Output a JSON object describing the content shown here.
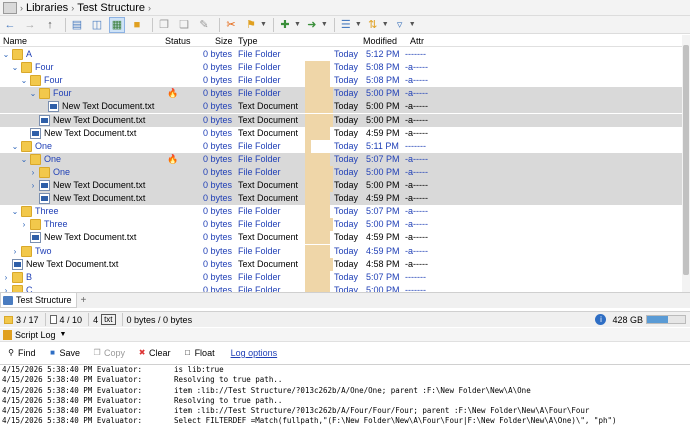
{
  "breadcrumb": [
    "Libraries",
    "Test Structure"
  ],
  "columns": {
    "name": "Name",
    "status": "Status",
    "size": "Size",
    "type": "Type",
    "modified": "Modified",
    "attr": "Attr"
  },
  "rows": [
    {
      "chev": "v",
      "icon": "folder",
      "name": "A",
      "status": "",
      "size": "0 bytes",
      "type": "File Folder",
      "day": "Today",
      "time": "5:12 PM",
      "attr": "-------",
      "style": "blue",
      "age": 0.0
    },
    {
      "chev": "v",
      "icon": "folder",
      "name": "Four",
      "status": "",
      "size": "0 bytes",
      "type": "File Folder",
      "day": "Today",
      "time": "5:08 PM",
      "attr": "-a-----",
      "style": "blue",
      "age": 0.9
    },
    {
      "chev": "v",
      "icon": "folder",
      "name": "Four",
      "status": "",
      "size": "0 bytes",
      "type": "File Folder",
      "day": "Today",
      "time": "5:08 PM",
      "attr": "-a-----",
      "style": "blue",
      "age": 0.9
    },
    {
      "chev": "v",
      "icon": "folder",
      "name": "Four",
      "status": "fire",
      "size": "0 bytes",
      "type": "File Folder",
      "day": "Today",
      "time": "5:00 PM",
      "attr": "-a-----",
      "style": "blue",
      "age": 1.0,
      "hl": true
    },
    {
      "chev": "",
      "icon": "file",
      "name": "New Text Document.txt",
      "status": "",
      "size": "0 bytes",
      "type": "Text Document",
      "day": "Today",
      "time": "5:00 PM",
      "attr": "-a-----",
      "style": "black",
      "age": 1.0,
      "hl": true
    },
    {
      "chev": "",
      "icon": "file",
      "name": "New Text Document.txt",
      "status": "",
      "size": "0 bytes",
      "type": "Text Document",
      "day": "Today",
      "time": "5:00 PM",
      "attr": "-a-----",
      "style": "black",
      "age": 1.0,
      "hl": true
    },
    {
      "chev": "",
      "icon": "file",
      "name": "New Text Document.txt",
      "status": "",
      "size": "0 bytes",
      "type": "Text Document",
      "day": "Today",
      "time": "4:59 PM",
      "attr": "-a-----",
      "style": "black",
      "age": 0.9
    },
    {
      "chev": "v",
      "icon": "folder",
      "name": "One",
      "status": "",
      "size": "0 bytes",
      "type": "File Folder",
      "day": "Today",
      "time": "5:11 PM",
      "attr": "-------",
      "style": "blue",
      "age": 0.2
    },
    {
      "chev": "v",
      "icon": "folder",
      "name": "One",
      "status": "fire",
      "size": "0 bytes",
      "type": "File Folder",
      "day": "Today",
      "time": "5:07 PM",
      "attr": "-a-----",
      "style": "blue",
      "age": 0.9,
      "hl": true
    },
    {
      "chev": ">",
      "icon": "folder",
      "name": "One",
      "status": "",
      "size": "0 bytes",
      "type": "File Folder",
      "day": "Today",
      "time": "5:00 PM",
      "attr": "-a-----",
      "style": "blue",
      "age": 1.0,
      "hl": true
    },
    {
      "chev": ">",
      "icon": "file",
      "name": "New Text Document.txt",
      "status": "",
      "size": "0 bytes",
      "type": "Text Document",
      "day": "Today",
      "time": "5:00 PM",
      "attr": "-a-----",
      "style": "black",
      "age": 1.0,
      "hl": true
    },
    {
      "chev": "",
      "icon": "file",
      "name": "New Text Document.txt",
      "status": "",
      "size": "0 bytes",
      "type": "Text Document",
      "day": "Today",
      "time": "4:59 PM",
      "attr": "-a-----",
      "style": "black",
      "age": 0.9,
      "hl": true
    },
    {
      "chev": "v",
      "icon": "folder",
      "name": "Three",
      "status": "",
      "size": "0 bytes",
      "type": "File Folder",
      "day": "Today",
      "time": "5:07 PM",
      "attr": "-a-----",
      "style": "blue",
      "age": 0.9
    },
    {
      "chev": ">",
      "icon": "folder",
      "name": "Three",
      "status": "",
      "size": "0 bytes",
      "type": "File Folder",
      "day": "Today",
      "time": "5:00 PM",
      "attr": "-a-----",
      "style": "blue",
      "age": 1.0
    },
    {
      "chev": "",
      "icon": "file",
      "name": "New Text Document.txt",
      "status": "",
      "size": "0 bytes",
      "type": "Text Document",
      "day": "Today",
      "time": "4:59 PM",
      "attr": "-a-----",
      "style": "black",
      "age": 0.9
    },
    {
      "chev": ">",
      "icon": "folder",
      "name": "Two",
      "status": "",
      "size": "0 bytes",
      "type": "File Folder",
      "day": "Today",
      "time": "4:59 PM",
      "attr": "-a-----",
      "style": "blue",
      "age": 0.9
    },
    {
      "chev": "",
      "icon": "file",
      "name": "New Text Document.txt",
      "status": "",
      "size": "0 bytes",
      "type": "Text Document",
      "day": "Today",
      "time": "4:58 PM",
      "attr": "-a-----",
      "style": "black",
      "age": 1.0
    },
    {
      "chev": ">",
      "icon": "folder",
      "name": "B",
      "status": "",
      "size": "0 bytes",
      "type": "File Folder",
      "day": "Today",
      "time": "5:07 PM",
      "attr": "-------",
      "style": "blue",
      "age": 0.9
    },
    {
      "chev": ">",
      "icon": "folder",
      "name": "C",
      "status": "",
      "size": "0 bytes",
      "type": "File Folder",
      "day": "Today",
      "time": "5:00 PM",
      "attr": "-------",
      "style": "blue",
      "age": 0.9
    }
  ],
  "tabs": {
    "active": "Test Structure",
    "add": "+"
  },
  "statusbar": {
    "selected": "3 / 17",
    "files": "4 / 10",
    "count": "4",
    "count_box": "txt",
    "bytes": "0 bytes / 0 bytes",
    "info": "i",
    "drive": "428 GB",
    "drive_used": 0.55
  },
  "log": {
    "title": "Script Log",
    "buttons": {
      "find": "Find",
      "save": "Save",
      "copy": "Copy",
      "clear": "Clear",
      "float": "Float"
    },
    "options": "Log options",
    "lines": [
      {
        "ts": "4/15/2026 5:38:40 PM Evaluator:",
        "msg": "is lib:true"
      },
      {
        "ts": "4/15/2026 5:38:40 PM Evaluator:",
        "msg": "Resolving to true path.."
      },
      {
        "ts": "4/15/2026 5:38:40 PM Evaluator:",
        "msg": "item :lib://Test Structure/?013c262b/A/One/One; parent :F:\\New Folder\\New\\A\\One"
      },
      {
        "ts": "4/15/2026 5:38:40 PM Evaluator:",
        "msg": "Resolving to true path.."
      },
      {
        "ts": "4/15/2026 5:38:40 PM Evaluator:",
        "msg": "item :lib://Test Structure/?013c262b/A/Four/Four/Four; parent :F:\\New Folder\\New\\A\\Four\\Four"
      },
      {
        "ts": "4/15/2026 5:38:40 PM Evaluator:",
        "msg": "Select FILTERDEF =Match(fullpath,\"(F:\\New Folder\\New\\A\\Four\\Four|F:\\New Folder\\New\\A\\One)\\\", \"ph\")"
      }
    ]
  }
}
